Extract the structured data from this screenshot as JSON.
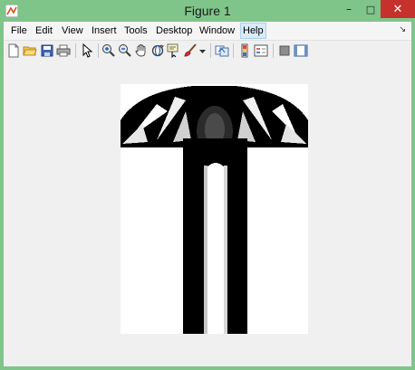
{
  "window": {
    "title": "Figure 1",
    "icon": "matlab-figure-icon",
    "controls": [
      "minimize-icon",
      "maximize-icon",
      "close-icon"
    ],
    "close_color": "#c7312b",
    "frame_color": "#7fc58a"
  },
  "menu": {
    "items": [
      "File",
      "Edit",
      "View",
      "Insert",
      "Tools",
      "Desktop",
      "Window",
      "Help"
    ],
    "active": "Help"
  },
  "toolbar": {
    "buttons": [
      "new-figure-icon",
      "open-file-icon",
      "save-icon",
      "print-icon",
      "edit-plot-arrow-icon",
      "zoom-in-icon",
      "zoom-out-icon",
      "pan-hand-icon",
      "rotate-3d-icon",
      "data-cursor-icon",
      "brush-icon",
      "brush-dropdown-icon",
      "link-plot-icon",
      "colorbar-icon",
      "legend-icon",
      "hide-plot-tools-icon",
      "show-plot-tools-icon"
    ]
  },
  "figure": {
    "content": "grayscale-image",
    "image_colors": {
      "foreground": "#000000",
      "background": "#ffffff"
    }
  }
}
